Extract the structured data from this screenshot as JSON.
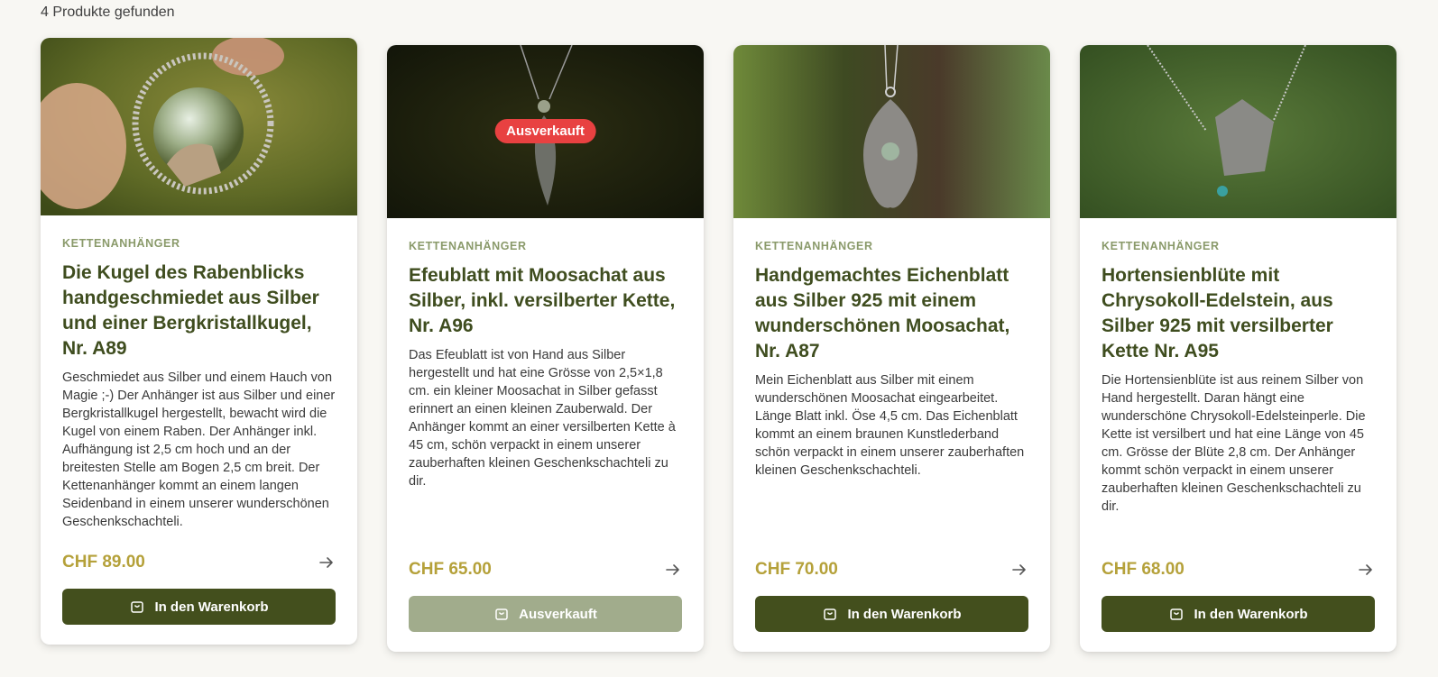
{
  "result_count": "4 Produkte gefunden",
  "products": [
    {
      "category": "KETTENANHÄNGER",
      "title": "Die Kugel des Rabenblicks handgeschmiedet aus Silber und einer Bergkristallkugel, Nr. A89",
      "description": "Geschmiedet aus Silber und einem Hauch von Magie ;-) Der Anhänger ist aus Silber und einer Bergkristallkugel hergestellt, bewacht wird die Kugel von einem Raben. Der Anhänger inkl. Aufhängung ist 2,5 cm hoch und an der breitesten Stelle am Bogen 2,5 cm breit. Der Kettenanhänger kommt an einem langen Seidenband in einem unserer wunderschönen Geschenkschachteli.",
      "price": "CHF 89.00",
      "button_label": "In den Warenkorb",
      "sold_out": false
    },
    {
      "category": "KETTENANHÄNGER",
      "title": "Efeublatt mit Moosachat aus Silber, inkl. versilberter Kette, Nr. A96",
      "description": "Das Efeublatt ist von Hand aus Silber hergestellt und hat eine Grösse von 2,5×1,8 cm. ein kleiner Moosachat in Silber gefasst erinnert an einen kleinen Zauberwald. Der Anhänger kommt an einer versilberten Kette à 45 cm, schön verpackt in einem unserer zauberhaften kleinen Geschenkschachteli zu dir.",
      "price": "CHF 65.00",
      "button_label": "Ausverkauft",
      "badge": "Ausverkauft",
      "sold_out": true
    },
    {
      "category": "KETTENANHÄNGER",
      "title": "Handgemachtes Eichenblatt aus Silber 925 mit einem wunderschönen Moosachat, Nr. A87",
      "description": "Mein Eichenblatt aus Silber mit einem wunderschönen Moosachat eingearbeitet. Länge Blatt inkl. Öse 4,5 cm. Das Eichenblatt kommt an einem braunen Kunstlederband schön verpackt in einem unserer zauberhaften kleinen Geschenkschachteli.",
      "price": "CHF 70.00",
      "button_label": "In den Warenkorb",
      "sold_out": false
    },
    {
      "category": "KETTENANHÄNGER",
      "title": "Hortensienblüte mit Chrysokoll-Edelstein, aus Silber 925 mit versilberter Kette Nr. A95",
      "description": "Die Hortensienblüte ist aus reinem Silber von Hand hergestellt. Daran hängt eine wunderschöne Chrysokoll-Edelsteinperle. Die Kette ist versilbert und hat eine Länge von 45 cm. Grösse der Blüte 2,8 cm. Der Anhänger kommt schön verpackt in einem unserer zauberhaften kleinen Geschenkschachteli zu dir.",
      "price": "CHF 68.00",
      "button_label": "In den Warenkorb",
      "sold_out": false
    }
  ],
  "icons": {
    "cart": "shopping-bag-icon",
    "arrow": "arrow-right-icon"
  },
  "colors": {
    "title": "#3f4d1f",
    "price": "#b5a13a",
    "button": "#434f1d",
    "button_disabled": "#a1ac8c",
    "badge": "#e84141",
    "category": "#8a9a6a"
  }
}
